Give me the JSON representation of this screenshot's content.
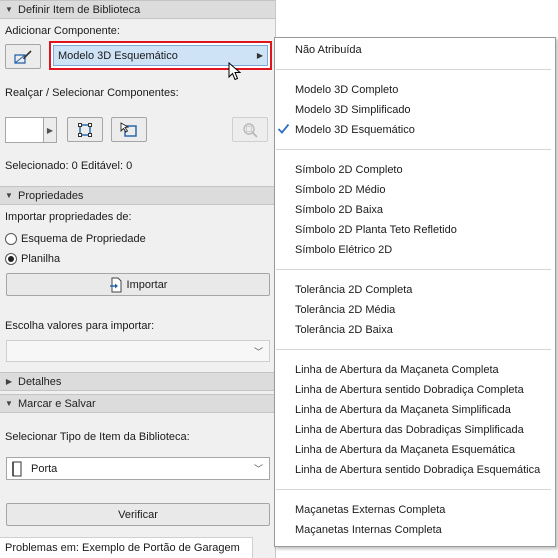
{
  "panel": {
    "section_define": "Definir Item de Biblioteca",
    "add_component_label": "Adicionar Componente:",
    "component_dropdown_value": "Modelo 3D Esquemático",
    "highlight_label": "Realçar / Selecionar Componentes:",
    "selected_status": "Selecionado: 0 Editável: 0",
    "section_properties": "Propriedades",
    "import_from_label": "Importar propriedades de:",
    "radio_scheme": "Esquema de Propriedade",
    "radio_spreadsheet": "Planilha",
    "import_button": "Importar",
    "choose_values_label": "Escolha valores para importar:",
    "section_details": "Detalhes",
    "section_mark_save": "Marcar e Salvar",
    "select_type_label": "Selecionar Tipo de Item da Biblioteca:",
    "type_value": "Porta",
    "verify_button": "Verificar",
    "status_tab": "Problemas em: Exemplo de Portão de Garagem"
  },
  "menu": {
    "group1": [
      "Não Atribuída"
    ],
    "group2": [
      "Modelo 3D Completo",
      "Modelo 3D Simplificado",
      "Modelo 3D Esquemático"
    ],
    "checked_item": "Modelo 3D Esquemático",
    "group3": [
      "Símbolo 2D Completo",
      "Símbolo 2D Médio",
      "Símbolo 2D Baixa",
      "Símbolo 2D Planta Teto Refletido",
      "Símbolo Elétrico 2D"
    ],
    "group4": [
      "Tolerância 2D Completa",
      "Tolerância 2D Média",
      "Tolerância 2D Baixa"
    ],
    "group5": [
      "Linha de Abertura da Maçaneta Completa",
      "Linha de Abertura sentido Dobradiça Completa",
      "Linha de Abertura da Maçaneta Simplificada",
      "Linha de Abertura das Dobradiças Simplificada",
      "Linha de Abertura da Maçaneta Esquemática",
      "Linha de Abertura sentido Dobradiça Esquemática"
    ],
    "group6": [
      "Maçanetas Externas Completa",
      "Maçanetas Internas Completa"
    ]
  },
  "colors": {
    "highlight_border": "#e0141e",
    "dropdown_fill": "#cfe3f7",
    "check_accent": "#2f6fc0"
  },
  "icons": {
    "add_component": "add-component-icon",
    "select_all": "select-frame-icon",
    "select_subset": "select-frame-arrow-icon",
    "zoom": "zoom-icon",
    "import": "import-file-icon",
    "door_type": "door-icon"
  }
}
